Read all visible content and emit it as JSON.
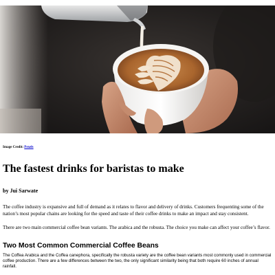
{
  "hero_image": {
    "subject": "latte-art-cup-photo"
  },
  "image_credit": {
    "prefix": "Image Credit: ",
    "link_text": "Pexels"
  },
  "article": {
    "title": "The fastest drinks for baristas to make",
    "byline": "by Jui Sarwate",
    "paragraph_1": "The coffee industry is expansive and full of demand as it relates to flavor and delivery of drinks. Customers frequenting some of the nation’s most popular chains are looking for the speed and taste of their coffee drinks to make an impact and stay consistent.",
    "paragraph_2": "There are two main commercial coffee bean variants. The arabica and the robusta. The choice you make can affect your coffee’s flavor.",
    "section_heading": "Two Most Common Commercial Coffee Beans",
    "paragraph_3": "The Coffea Arabica and the Coffea canephora, specifically the robusta variety are the coffee bean variants most commonly used in commercial coffee production. There are a few differences between the two, the only significant similarity being that both require 60 inches of annual rainfall."
  },
  "colors": {
    "link": "#0000cc",
    "text": "#000000",
    "background": "#ffffff"
  }
}
